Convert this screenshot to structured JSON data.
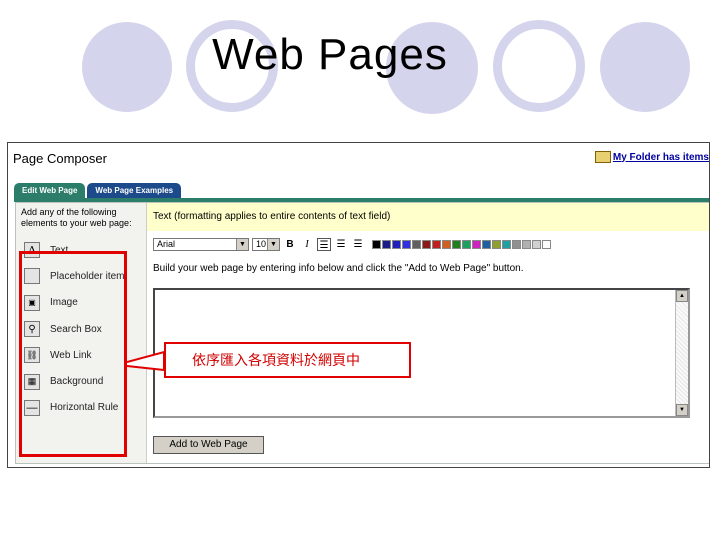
{
  "slide": {
    "title": "Web Pages"
  },
  "composer": {
    "title": "Page Composer",
    "folder_link": "My Folder has items",
    "tabs": [
      {
        "label": "Edit Web Page",
        "active": true
      },
      {
        "label": "Web Page Examples",
        "active": false
      }
    ],
    "instructions": "Add any of the following elements to your web page:",
    "elements": [
      {
        "label": "Text",
        "icon": "text-icon"
      },
      {
        "label": "Placeholder item",
        "icon": "placeholder-icon"
      },
      {
        "label": "Image",
        "icon": "image-icon"
      },
      {
        "label": "Search Box",
        "icon": "search-icon"
      },
      {
        "label": "Web Link",
        "icon": "web-link-icon"
      },
      {
        "label": "Background",
        "icon": "background-icon"
      },
      {
        "label": "Horizontal Rule",
        "icon": "horizontal-rule-icon"
      }
    ],
    "text_header": "Text (formatting applies to entire contents of text field)",
    "font_value": "Arial",
    "size_value": "10",
    "format_buttons": [
      "B",
      "I"
    ],
    "palette": [
      "#000000",
      "#1a1a8a",
      "#2020c0",
      "#3030e0",
      "#606060",
      "#8a1a1a",
      "#c02020",
      "#d06020",
      "#208020",
      "#20a060",
      "#d020c0",
      "#2060a0",
      "#90a030",
      "#20a0a0",
      "#909090",
      "#b0b0b0",
      "#d0d0d0",
      "#ffffff"
    ],
    "build_text": "Build your web page by entering info below and click the \"Add to Web Page\" button.",
    "add_button": "Add to Web Page"
  },
  "callout": {
    "text": "依序匯入各項資料於網頁中"
  },
  "colors": {
    "highlight": "#e00000",
    "circle": "#d4d4ec",
    "tab_active": "#2c7d6a",
    "tab_inactive": "#1d4a8a",
    "text_header_bg": "#ffffcc"
  }
}
